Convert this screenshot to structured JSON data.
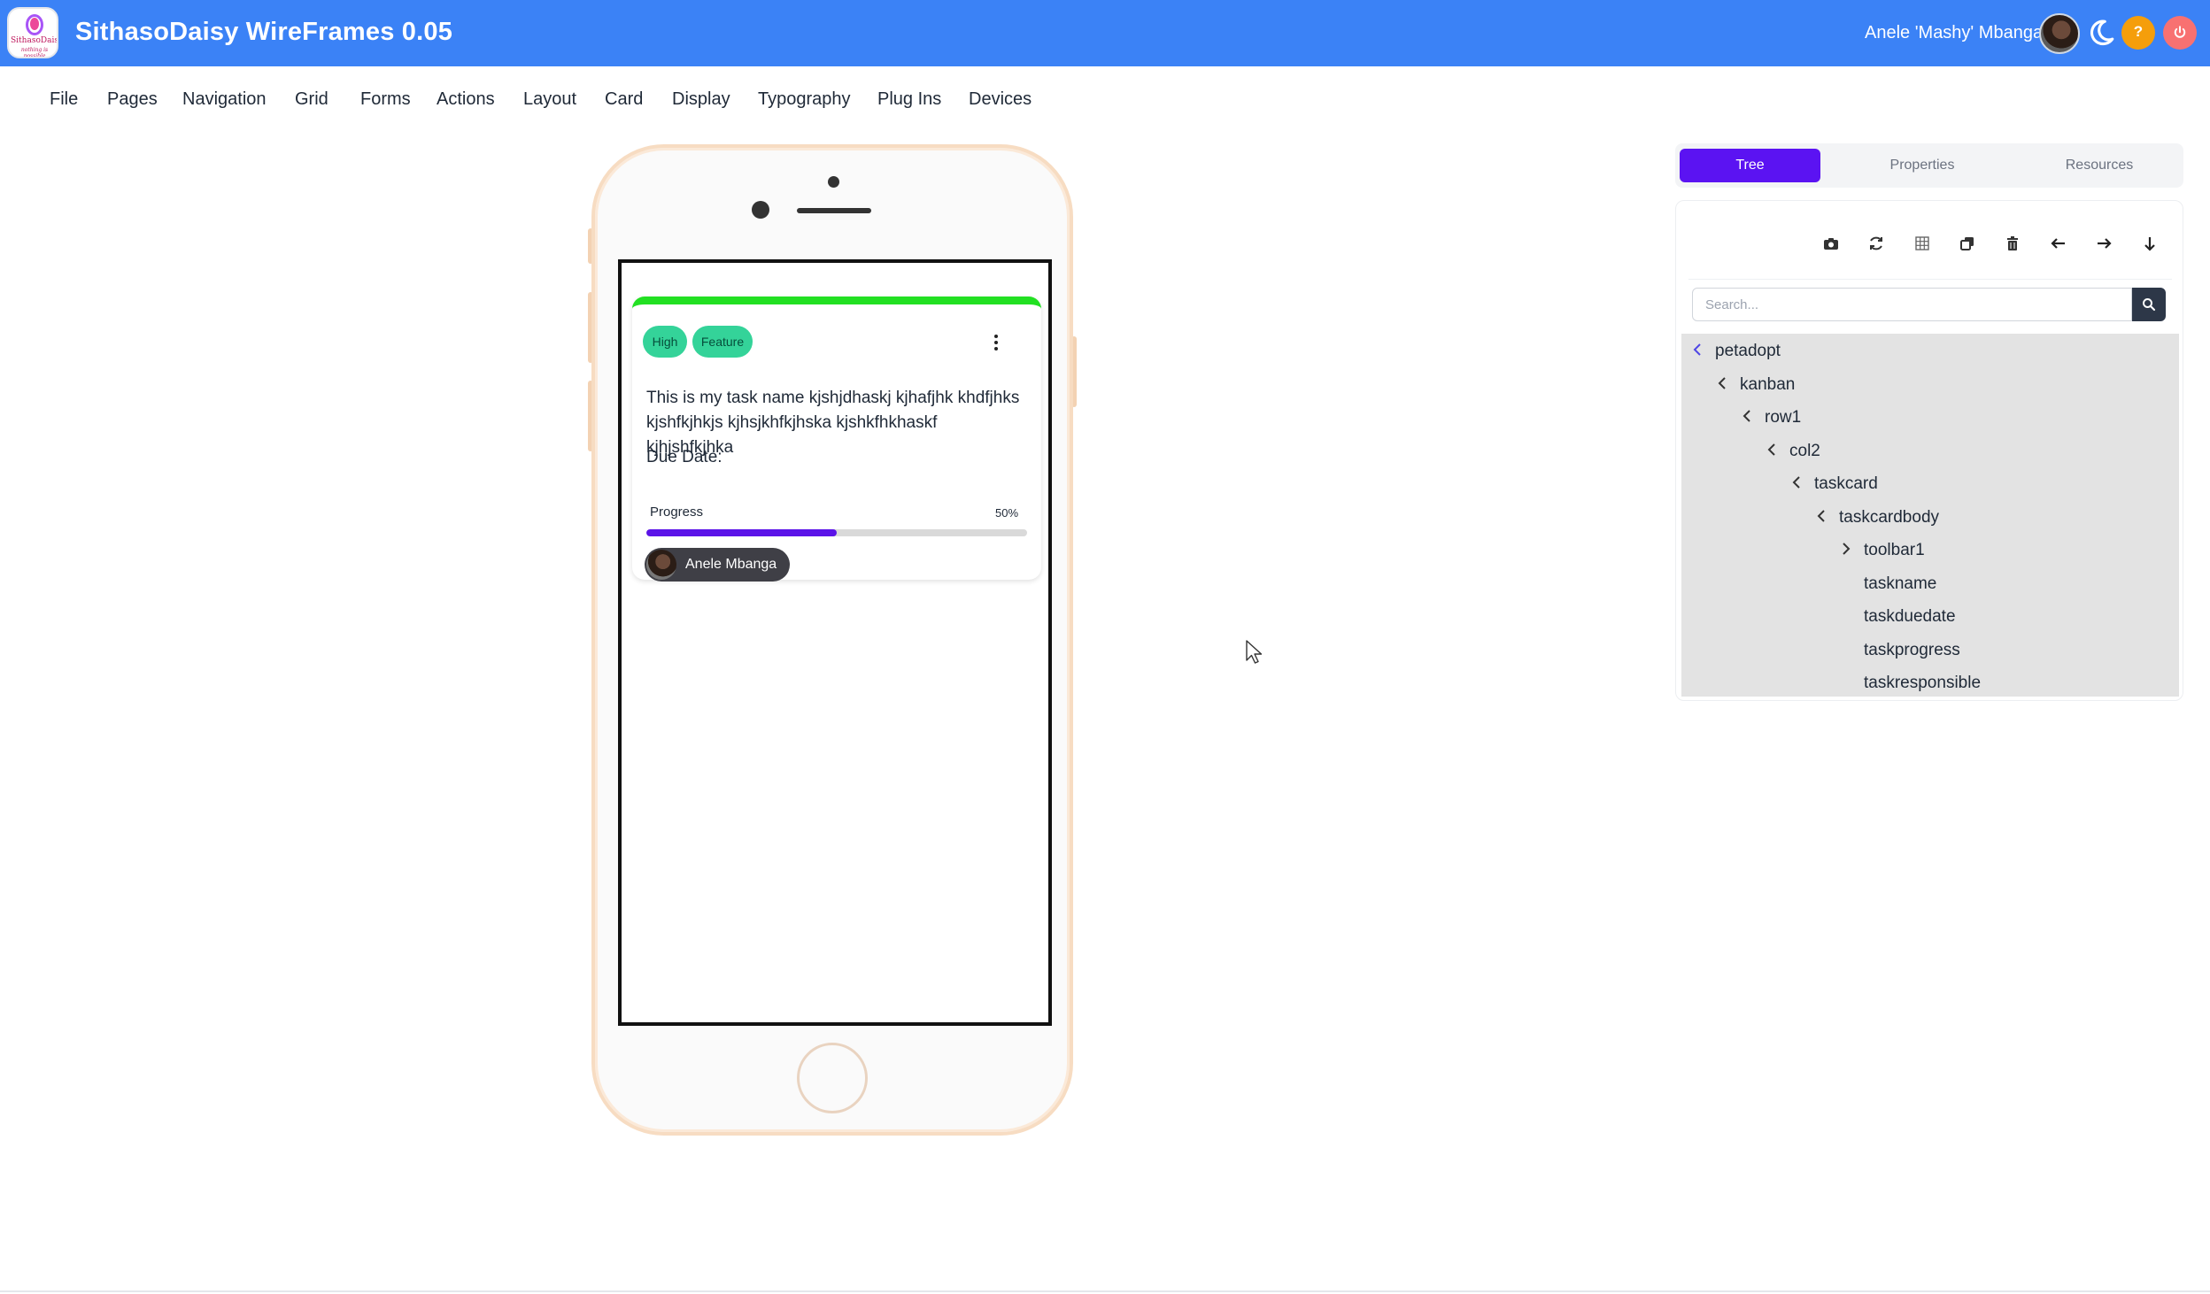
{
  "header": {
    "title": "SithasoDaisy WireFrames 0.05",
    "logo_text": "SithasoDaisy",
    "logo_tagline": "nothing is possible",
    "user_name": "Anele 'Mashy' Mbanga",
    "brand_color": "#3b82f6"
  },
  "menu": [
    "File",
    "Pages",
    "Navigation",
    "Grid",
    "Forms",
    "Actions",
    "Layout",
    "Card",
    "Display",
    "Typography",
    "Plug Ins",
    "Devices"
  ],
  "taskcard": {
    "accent_color": "#22e022",
    "badges": [
      "High",
      "Feature"
    ],
    "task_name": "This is my task name kjshjdhaskj kjhafjhk khdfjhks kjshfkjhkjs kjhsjkhfkjhska kjshkfhkhaskf kjhjshfkjhka",
    "due_label": "Due Date:",
    "progress_label": "Progress",
    "progress_text": "50%",
    "progress_value": 50,
    "responsible": "Anele Mbanga"
  },
  "panel": {
    "tabs": [
      "Tree",
      "Properties",
      "Resources"
    ],
    "active_tab": "Tree",
    "toolbar_icons": [
      "camera-icon",
      "refresh-icon",
      "grid-icon",
      "copy-icon",
      "trash-icon",
      "arrow-left-icon",
      "arrow-right-icon",
      "arrow-down-icon"
    ],
    "search_placeholder": "Search...",
    "tree": [
      {
        "label": "petadopt",
        "depth": 0,
        "state": "expanded"
      },
      {
        "label": "kanban",
        "depth": 1,
        "state": "expanded"
      },
      {
        "label": "row1",
        "depth": 2,
        "state": "expanded"
      },
      {
        "label": "col2",
        "depth": 3,
        "state": "expanded"
      },
      {
        "label": "taskcard",
        "depth": 4,
        "state": "expanded"
      },
      {
        "label": "taskcardbody",
        "depth": 5,
        "state": "expanded"
      },
      {
        "label": "toolbar1",
        "depth": 6,
        "state": "collapsed"
      },
      {
        "label": "taskname",
        "depth": 6,
        "state": "leaf"
      },
      {
        "label": "taskduedate",
        "depth": 6,
        "state": "leaf"
      },
      {
        "label": "taskprogress",
        "depth": 6,
        "state": "leaf"
      },
      {
        "label": "taskresponsible",
        "depth": 6,
        "state": "leaf"
      }
    ]
  }
}
